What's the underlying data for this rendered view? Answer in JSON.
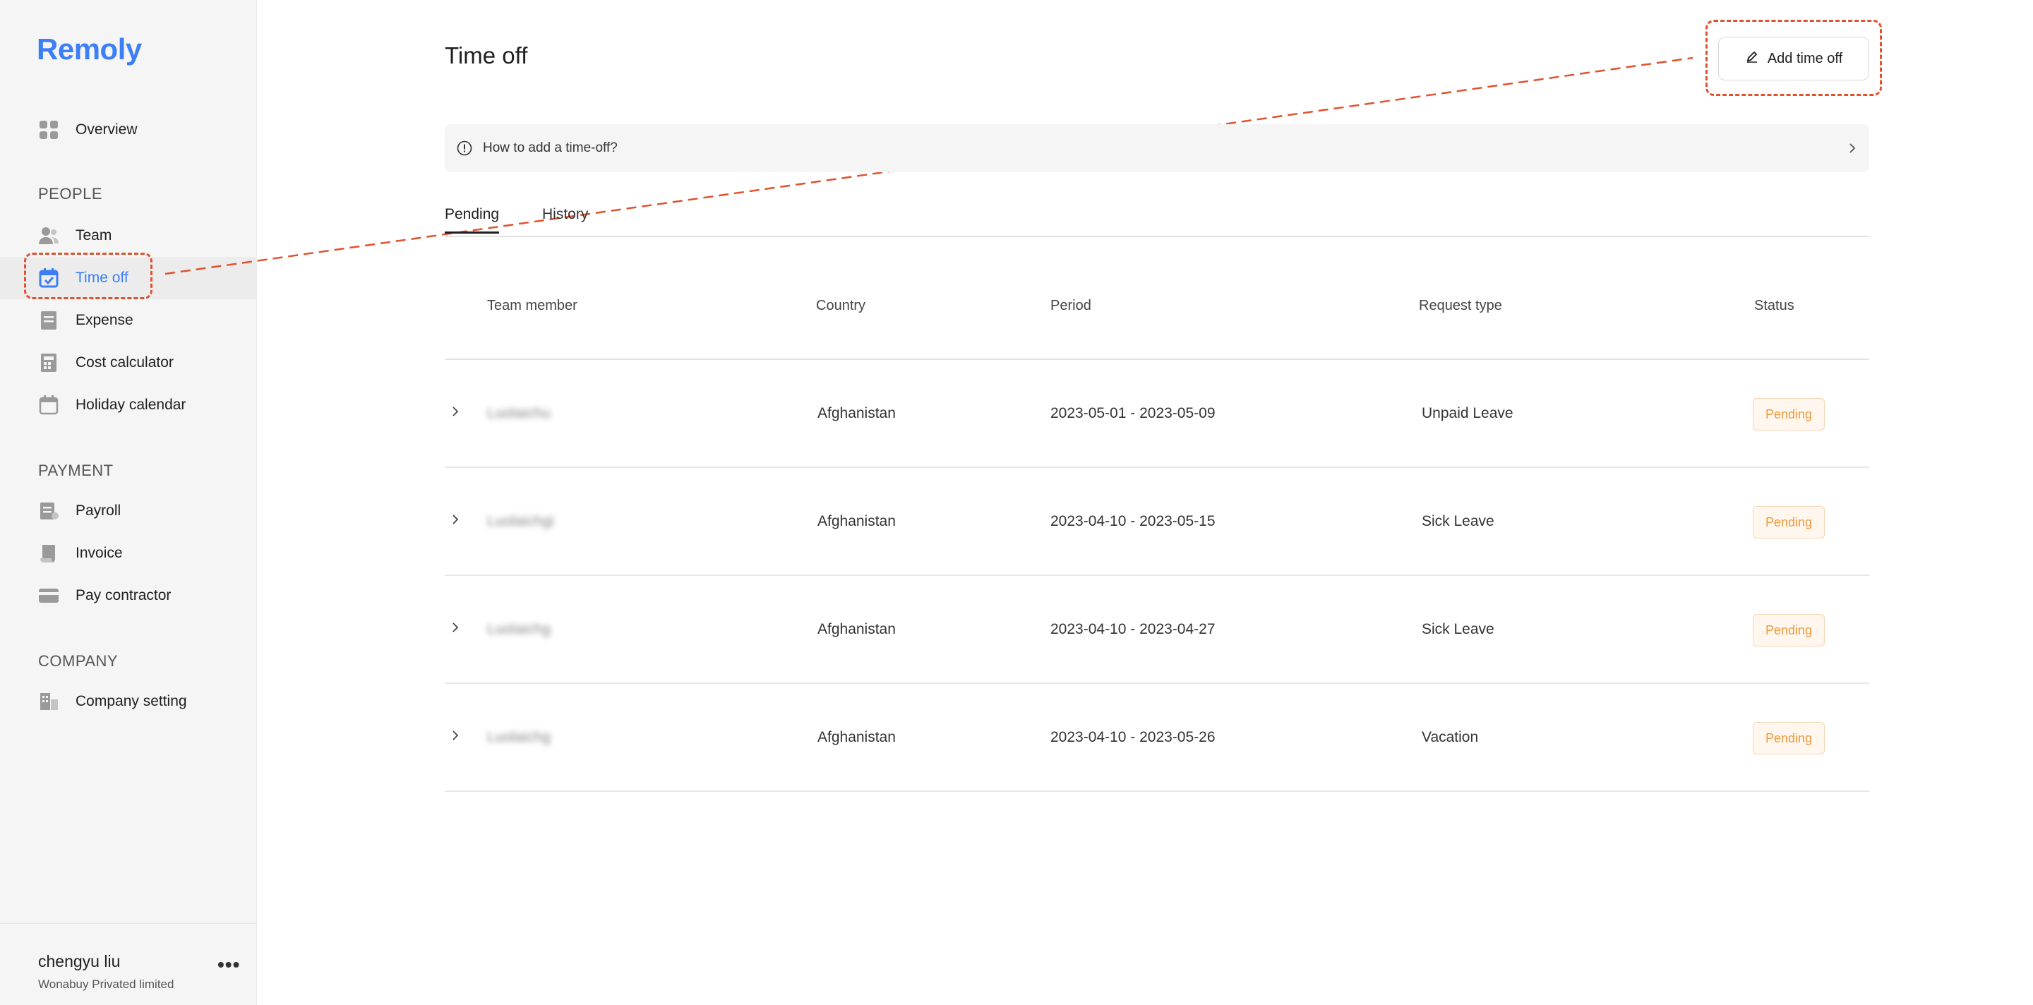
{
  "app": {
    "logo": "Remoly"
  },
  "sidebar": {
    "overview": "Overview",
    "sections": {
      "people": "PEOPLE",
      "payment": "PAYMENT",
      "company": "COMPANY"
    },
    "items": {
      "team": "Team",
      "time_off": "Time off",
      "expense": "Expense",
      "cost_calculator": "Cost calculator",
      "holiday_calendar": "Holiday calendar",
      "payroll": "Payroll",
      "invoice": "Invoice",
      "pay_contractor": "Pay contractor",
      "company_setting": "Company setting"
    },
    "user": {
      "name": "chengyu liu",
      "org": "Wonabuy Privated limited",
      "more": "•••"
    }
  },
  "main": {
    "title": "Time off",
    "add_button": "Add time off",
    "info_banner": "How to add a time-off?",
    "tabs": [
      "Pending",
      "History"
    ],
    "columns": [
      "Team member",
      "Country",
      "Period",
      "Request type",
      "Status"
    ],
    "rows": [
      {
        "member": "Luolaichu",
        "country": "Afghanistan",
        "period": "2023-05-01 - 2023-05-09",
        "type": "Unpaid Leave",
        "status": "Pending"
      },
      {
        "member": "Luolaichgi",
        "country": "Afghanistan",
        "period": "2023-04-10 - 2023-05-15",
        "type": "Sick Leave",
        "status": "Pending"
      },
      {
        "member": "Luolaichg",
        "country": "Afghanistan",
        "period": "2023-04-10 - 2023-04-27",
        "type": "Sick Leave",
        "status": "Pending"
      },
      {
        "member": "Luolaichg",
        "country": "Afghanistan",
        "period": "2023-04-10 - 2023-05-26",
        "type": "Vacation",
        "status": "Pending"
      }
    ]
  },
  "colors": {
    "accent": "#3b7ef6",
    "annotation": "#e0512f",
    "pending_text": "#f09a3e",
    "pending_bg": "#fff7ee"
  }
}
